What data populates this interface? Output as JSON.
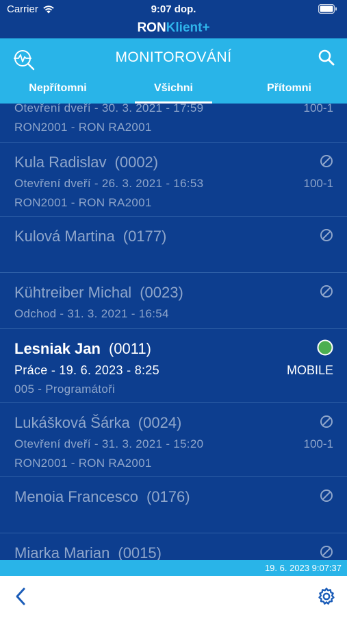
{
  "status_bar": {
    "carrier": "Carrier",
    "time": "9:07 dop."
  },
  "brand": {
    "part1": "RON",
    "part2": "Klient+"
  },
  "header": {
    "title": "MONITOROVÁNÍ"
  },
  "tabs": [
    {
      "label": "Nepřítomni"
    },
    {
      "label": "Všichni",
      "active": true
    },
    {
      "label": "Přítomni"
    }
  ],
  "rows": [
    {
      "name": "",
      "code": "",
      "event": "Otevření dveří - 30. 3. 2021 - 17:59",
      "terminal": "100-1",
      "location": "RON2001 - RON RA2001",
      "status": "blocked"
    },
    {
      "name": "Kula Radislav",
      "code": "(0002)",
      "event": "Otevření dveří - 26. 3. 2021 - 16:53",
      "terminal": "100-1",
      "location": "RON2001 - RON RA2001",
      "status": "blocked"
    },
    {
      "name": "Kulová Martina",
      "code": "(0177)",
      "event": "",
      "terminal": "",
      "location": "",
      "status": "blocked"
    },
    {
      "name": "Kühtreiber Michal",
      "code": "(0023)",
      "event": "Odchod - 31. 3. 2021 - 16:54",
      "terminal": "",
      "location": "",
      "status": "blocked"
    },
    {
      "name": "Lesniak Jan",
      "code": "(0011)",
      "event": "Práce - 19. 6. 2023 - 8:25",
      "terminal": "MOBILE",
      "location": "005 - Programátoři",
      "status": "present"
    },
    {
      "name": "Lukášková Šárka",
      "code": "(0024)",
      "event": "Otevření dveří - 31. 3. 2021 - 15:20",
      "terminal": "100-1",
      "location": "RON2001 - RON RA2001",
      "status": "blocked"
    },
    {
      "name": "Menoia Francesco",
      "code": "(0176)",
      "event": "",
      "terminal": "",
      "location": "",
      "status": "blocked"
    },
    {
      "name": "Miarka Marian",
      "code": "(0015)",
      "event": "",
      "terminal": "",
      "location": "",
      "status": "blocked"
    }
  ],
  "footer": {
    "timestamp": "19. 6. 2023 9:07:37"
  },
  "colors": {
    "navy": "#0d3e8f",
    "cyan": "#29b4e8",
    "present": "#4caf50"
  }
}
